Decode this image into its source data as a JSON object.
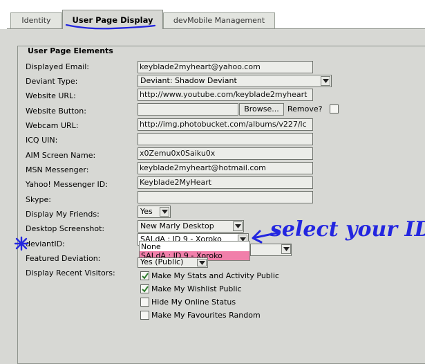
{
  "tabs": [
    {
      "label": "Identity",
      "active": false
    },
    {
      "label": "User Page Display",
      "active": true
    },
    {
      "label": "devMobile Management",
      "active": false
    }
  ],
  "section": {
    "legend": "User Page Elements"
  },
  "fields": {
    "displayed_email": {
      "label": "Displayed Email:",
      "value": "keyblade2myheart@yahoo.com"
    },
    "deviant_type": {
      "label": "Deviant Type:",
      "value": "Deviant: Shadow Deviant"
    },
    "website_url": {
      "label": "Website URL:",
      "value": "http://www.youtube.com/keyblade2myheart"
    },
    "website_button": {
      "label": "Website Button:",
      "browse_label": "Browse...",
      "remove_label": "Remove?"
    },
    "webcam_url": {
      "label": "Webcam URL:",
      "value": "http://img.photobucket.com/albums/v227/lc"
    },
    "icq_uin": {
      "label": "ICQ UIN:",
      "value": ""
    },
    "aim": {
      "label": "AIM Screen Name:",
      "value": "x0Zemu0x0Saiku0x"
    },
    "msn": {
      "label": "MSN Messenger:",
      "value": "keyblade2myheart@hotmail.com"
    },
    "yahoo": {
      "label": "Yahoo! Messenger ID:",
      "value": "Keyblade2MyHeart"
    },
    "skype": {
      "label": "Skype:",
      "value": ""
    },
    "display_friends": {
      "label": "Display My Friends:",
      "value": "Yes"
    },
    "desktop": {
      "label": "Desktop Screenshot:",
      "value": "New Marly Desktop"
    },
    "deviantid": {
      "label": "deviantID:",
      "value": "SAI.dA : ID 9 - Xoroko",
      "options": [
        "None",
        "SAI.dA : ID 9 - Xoroko"
      ]
    },
    "featured": {
      "label": "Featured Deviation:",
      "value": "Yes (Public)"
    },
    "recent": {
      "label": "Display Recent Visitors:"
    }
  },
  "checkboxes": [
    {
      "label": "Make My Stats and Activity Public",
      "checked": true
    },
    {
      "label": "Make My Wishlist Public",
      "checked": true
    },
    {
      "label": "Hide My Online Status",
      "checked": false
    },
    {
      "label": "Make My Favourites Random",
      "checked": false
    }
  ],
  "annotation": {
    "text": "select your ID",
    "marker": "*",
    "color": "#2326e0"
  }
}
